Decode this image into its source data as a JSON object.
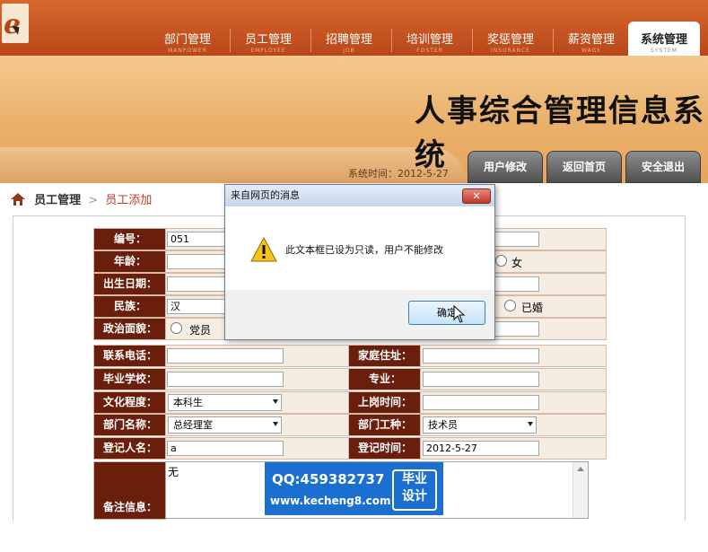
{
  "logo": {
    "letter": "e"
  },
  "nav": [
    {
      "label": "部门管理",
      "sub": "MANPOWER"
    },
    {
      "label": "员工管理",
      "sub": "EMPLOYEE"
    },
    {
      "label": "招聘管理",
      "sub": "JOB"
    },
    {
      "label": "培训管理",
      "sub": "FOSTER"
    },
    {
      "label": "奖惩管理",
      "sub": "INSURANCE"
    },
    {
      "label": "薪资管理",
      "sub": "WAGE"
    },
    {
      "label": "系统管理",
      "sub": "SYSTEM"
    }
  ],
  "banner": {
    "title": "人事综合管理信息系统",
    "sys_time": "系统时间：2012-5-27"
  },
  "tabs": {
    "user_edit": "用户修改",
    "home": "返回首页",
    "logout": "安全退出"
  },
  "breadcrumb": {
    "section": "员工管理",
    "arrow": ">",
    "page": "员工添加"
  },
  "form": {
    "labels": {
      "id": "编号：",
      "age": "年龄：",
      "birth": "出生日期：",
      "nation": "民族：",
      "politics": "政治面貌：",
      "phone": "联系电话：",
      "address": "家庭住址：",
      "school": "毕业学校：",
      "major": "专业：",
      "education": "文化程度：",
      "onboard": "上岗时间：",
      "dept": "部门名称：",
      "job": "部门工种：",
      "registrar": "登记人名：",
      "regtime": "登记时间：",
      "remark": "备注信息："
    },
    "values": {
      "id": "051",
      "nation": "汉",
      "education": "本科生",
      "dept": "总经理室",
      "job": "技术员",
      "registrar": "a",
      "regtime": "2012-5-27",
      "remark": "无"
    },
    "radios": {
      "female": "女",
      "married": "已婚",
      "party": "党员"
    }
  },
  "dialog": {
    "title": "来自网页的消息",
    "close": "✕",
    "message": "此文本框已设为只读，用户不能修改",
    "ok": "确定"
  },
  "ad": {
    "qq": "QQ:459382737",
    "url": "www.kecheng8.com",
    "badge_line1": "毕业",
    "badge_line2": "设计"
  }
}
